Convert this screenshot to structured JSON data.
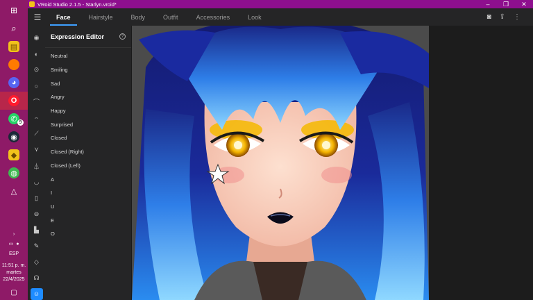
{
  "taskbar": {
    "icons": [
      {
        "name": "windows-start-icon",
        "glyph": "⊞",
        "color": "#ffffff"
      },
      {
        "name": "search-icon",
        "glyph": "⌕",
        "color": "#ffffff"
      },
      {
        "name": "file-explorer-icon",
        "glyph": "▤",
        "color": "#f2c21b"
      },
      {
        "name": "app-orange-icon",
        "glyph": "●",
        "color": "#ff7a00"
      },
      {
        "name": "discord-icon",
        "glyph": "◕",
        "color": "#5865f2"
      },
      {
        "name": "opera-icon",
        "glyph": "O",
        "color": "#ff1b2d"
      },
      {
        "name": "whatsapp-icon",
        "glyph": "✆",
        "color": "#25d366"
      },
      {
        "name": "steam-icon",
        "glyph": "◉",
        "color": "#1b2838"
      },
      {
        "name": "vroid-icon",
        "glyph": "◆",
        "color": "#f2c21b"
      },
      {
        "name": "earth-icon",
        "glyph": "◍",
        "color": "#3fb950"
      },
      {
        "name": "paint-icon",
        "glyph": "△",
        "color": "#ffffff"
      }
    ],
    "whatsapp_badge": "9",
    "tray": {
      "language": "ESP",
      "time": "11:51 p. m.",
      "day": "martes",
      "date": "22/4/2025"
    }
  },
  "titlebar": {
    "title": "VRoid Studio 2.1.5 - Starlyn.vroid*"
  },
  "nav": {
    "tabs": [
      "Face",
      "Hairstyle",
      "Body",
      "Outfit",
      "Accessories",
      "Look"
    ],
    "active_tab": "Face"
  },
  "panel": {
    "title": "Expression Editor",
    "help_glyph": "?",
    "expressions": [
      "Neutral",
      "Smiling",
      "Sad",
      "Angry",
      "Happy",
      "Surprised",
      "Closed",
      "Closed (Right)",
      "Closed (Left)",
      "A",
      "I",
      "U",
      "E",
      "O"
    ]
  },
  "rail": {
    "icons": [
      "eye-icon",
      "face-shape-icon",
      "eye-shape-icon",
      "face-outline-icon",
      "eyebrow-icon",
      "ear-icon",
      "brush-icon",
      "eyelash-icon",
      "nose-icon",
      "mouth-icon",
      "ear-shape-icon",
      "lips-icon",
      "chart-icon",
      "pencil-icon",
      "diamond-icon",
      "ear-right-icon",
      "expression-icon"
    ]
  },
  "colors": {
    "accent": "#1e8cff",
    "title_bar": "#8e0f8e",
    "taskbar": "#8e1a67"
  }
}
